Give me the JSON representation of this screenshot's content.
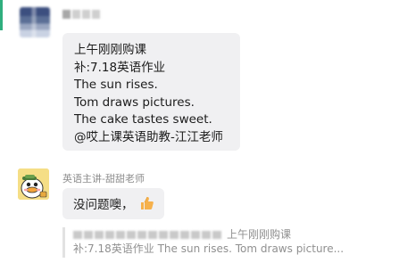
{
  "chat": {
    "message1": {
      "lines": [
        "上午刚刚购课",
        "补:7.18英语作业",
        "The sun rises.",
        "Tom draws pictures.",
        "The cake tastes sweet.",
        "@哎上课英语助教-江江老师"
      ]
    },
    "message2": {
      "sender": "英语主讲-甜甜老师",
      "text": "没问题噢，"
    },
    "quote": {
      "line1_tail": "上午刚刚购课",
      "line2": "补:7.18英语作业 The sun rises. Tom draws picture..."
    },
    "icons": {
      "thumb": "thumbs-up-icon",
      "avatar2": "duck-avatar-icon"
    },
    "colors": {
      "accent": "#2fae7e",
      "bubble": "#f0f0f2",
      "thumb": "#f6b14c"
    }
  }
}
